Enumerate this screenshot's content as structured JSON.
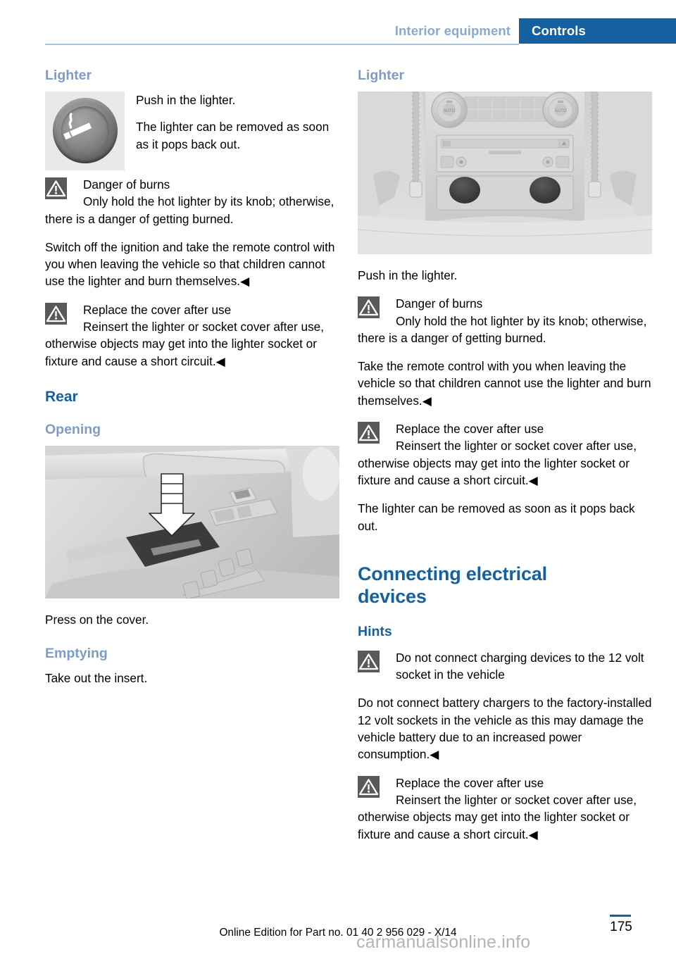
{
  "header": {
    "chapter": "Interior equipment",
    "section": "Controls"
  },
  "left_column": {
    "heading_lighter": "Lighter",
    "knob_caption_1": "Push in the lighter.",
    "knob_caption_2": "The lighter can be removed as soon as it pops back out.",
    "warning_burns": {
      "title": "Danger of burns",
      "text": "Only hold the hot lighter by its knob; otherwise, there is a danger of getting burned."
    },
    "paragraph_ignition": "Switch off the ignition and take the remote control with you when leaving the vehicle so that children cannot use the lighter and burn themselves.◀",
    "warning_cover": {
      "title": "Replace the cover after use",
      "text": "Reinsert the lighter or socket cover after use, otherwise objects may get into the lighter socket or fixture and cause a short circuit.◀"
    },
    "heading_rear": "Rear",
    "heading_opening": "Opening",
    "caption_press": "Press on the cover.",
    "heading_emptying": "Emptying",
    "caption_take_out": "Take out the insert."
  },
  "right_column": {
    "heading_lighter": "Lighter",
    "caption_push": "Push in the lighter.",
    "warning_burns": {
      "title": "Danger of burns",
      "text": "Only hold the hot lighter by its knob; otherwise, there is a danger of getting burned."
    },
    "paragraph_remote": "Take the remote control with you when leaving the vehicle so that children cannot use the lighter and burn themselves.◀",
    "warning_cover": {
      "title": "Replace the cover after use",
      "text": "Reinsert the lighter or socket cover after use, otherwise objects may get into the lighter socket or fixture and cause a short circuit.◀"
    },
    "paragraph_pops": "The lighter can be removed as soon as it pops back out.",
    "heading_connecting": "Connecting electrical devices",
    "heading_hints": "Hints",
    "warning_charging": {
      "title": "Do not connect charging devices to the 12 volt socket in the vehicle",
      "text": "Do not connect battery chargers to the factory-installed 12 volt sockets in the vehicle as this may damage the vehicle battery due to an increased power consumption.◀"
    },
    "warning_cover_2": {
      "title": "Replace the cover after use",
      "text": "Reinsert the lighter or socket cover after use, otherwise objects may get into the lighter socket or fixture and cause a short circuit.◀"
    }
  },
  "figures": {
    "lighter_knob_alt": "cigarette-lighter-knob",
    "door_panel_alt": "rear-door-panel-cover-press",
    "console_alt": "rear-center-console-lighter"
  },
  "footer": {
    "edition_line": "Online Edition for Part no. 01 40 2 956 029 - X/14",
    "page_number": "175",
    "watermark": "carmanualsonline.info"
  },
  "colors": {
    "banner_blue": "#15619f",
    "heading_blue": "#15619f",
    "subheading_blue": "#7c9cc8",
    "chapter_blue": "#8aa8d0",
    "rule_blue": "#a9c0de",
    "warning_gray": "#595959"
  }
}
